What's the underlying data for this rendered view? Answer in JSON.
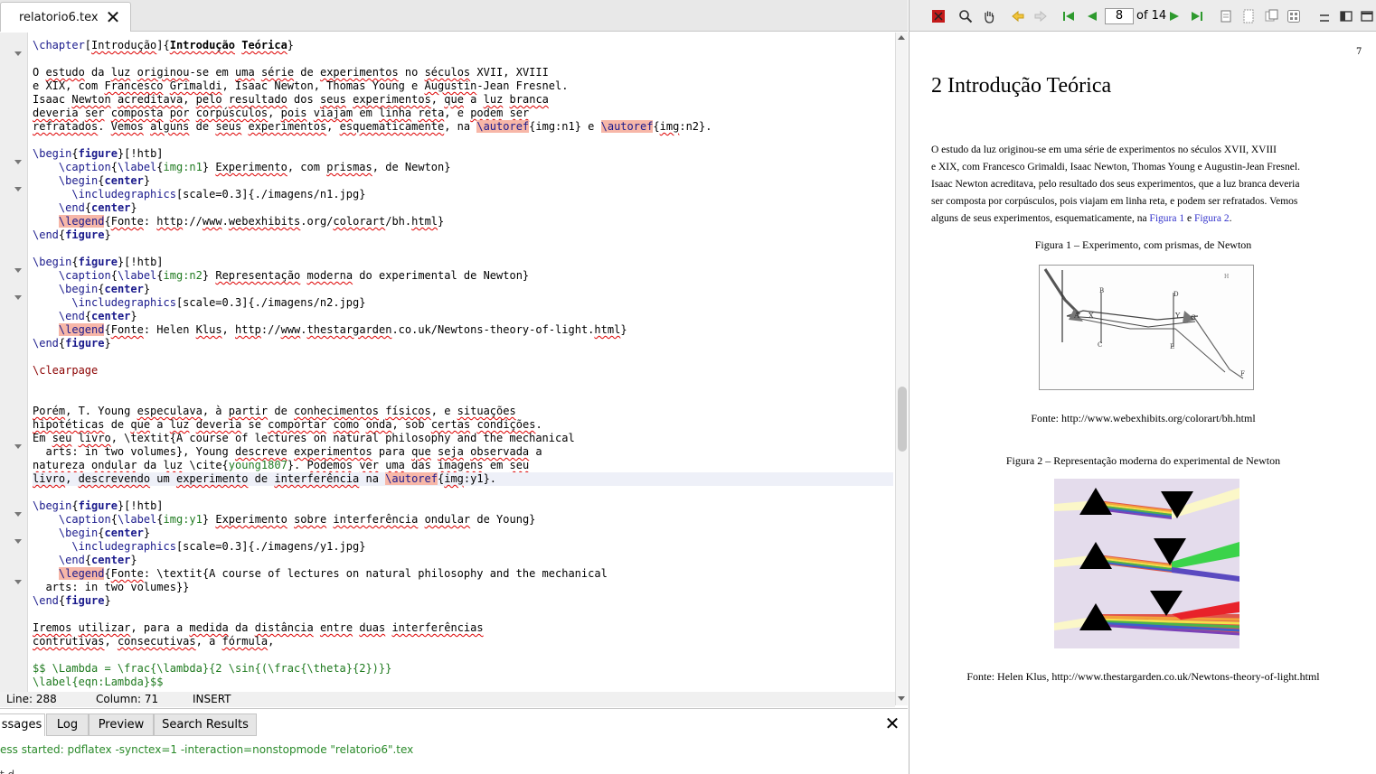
{
  "editor": {
    "tab_label": "relatorio6.tex",
    "status": {
      "line": "Line: 288",
      "column": "Column: 71",
      "mode": "INSERT"
    }
  },
  "panel": {
    "tabs": [
      "ssages",
      "Log",
      "Preview",
      "Search Results"
    ],
    "message": "ess started: pdflatex -synctex=1 -interaction=nonstopmode \"relatorio6\".tex",
    "message2": "     t   d         "
  },
  "pdf": {
    "page_current": "8",
    "page_of": "of 14",
    "page_number": "7",
    "chapter": "2  Introdução Teórica",
    "paragraph": [
      "         O estudo da luz originou-se em uma série de experimentos no séculos XVII, XVIII",
      "e XIX, com Francesco Grimaldi, Isaac Newton, Thomas Young e Augustin-Jean Fresnel.",
      "Isaac Newton acreditava, pelo resultado dos seus experimentos, que a luz branca deveria",
      "ser composta por corpúsculos, pois viajam em linha reta, e podem ser refratados. Vemos"
    ],
    "para_last_prefix": "alguns de seus experimentos, esquematicamente, na ",
    "link1": "Figura 1",
    "para_and": " e ",
    "link2": "Figura 2",
    "para_end": ".",
    "fig1_caption": "Figura 1 –  Experimento, com prismas, de Newton",
    "fig1_source": "Fonte: http://www.webexhibits.org/colorart/bh.html",
    "fig2_caption": "Figura 2 –  Representação moderna do experimental de Newton",
    "fig2_source": "Fonte: Helen Klus, http://www.thestargarden.co.uk/Newtons-theory-of-light.html",
    "fig1_labels": [
      "A",
      "X",
      "B",
      "C",
      "D",
      "Y",
      "E",
      "G",
      "F",
      "H"
    ]
  }
}
